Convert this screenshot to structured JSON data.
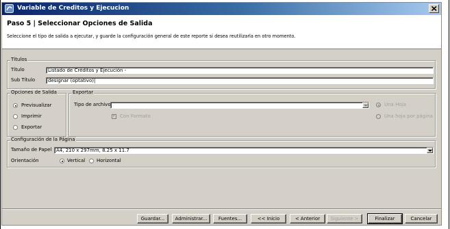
{
  "window": {
    "title": "Variable de Creditos y Ejecucion",
    "icon": "app-icon",
    "close": "close-icon"
  },
  "header": {
    "step": "Paso 5 | Seleccionar Opciones de Salida",
    "description": "Seleccione el tipo de salida a ejecutar, y guarde la configuración general de este reporte si desea reutilizarla en otro momento."
  },
  "titulos": {
    "legend": "Títulos",
    "titulo_label": "Título",
    "titulo_value": "Listado de Créditos y Ejecución -",
    "subtitulo_label": "Sub Título",
    "subtitulo_value": "designar (optativo)|"
  },
  "opciones": {
    "legend": "Opciones de Salida",
    "options": [
      "Previsualizar",
      "Imprimir",
      "Exportar"
    ],
    "selected": "Previsualizar"
  },
  "exportar": {
    "legend": "Exportar",
    "tipo_label": "Tipo de archivo",
    "tipo_value": "",
    "con_formato": "Con Formato",
    "una_hoja": "Una Hoja",
    "una_hoja_por_pagina": "Una hoja por página"
  },
  "pagina": {
    "legend": "Configuración de la Página",
    "tamano_label": "Tamaño de Papel",
    "tamano_value": "A4, 210 x 297mm, 8.25 x 11.7",
    "orientacion_label": "Orientación",
    "vertical": "Vertical",
    "horizontal": "Horizontal",
    "selected": "Vertical"
  },
  "buttons": {
    "guardar": "Guardar...",
    "administrar": "Administrar...",
    "fuentes": "Fuentes...",
    "inicio": "<< Inicio",
    "anterior": "< Anterior",
    "siguiente": "Siguiente >",
    "finalizar": "Finalizar",
    "cancelar": "Cancelar"
  },
  "colors": {
    "title_bar": "#0a246a",
    "dialog_bg": "#d4d0c8"
  }
}
